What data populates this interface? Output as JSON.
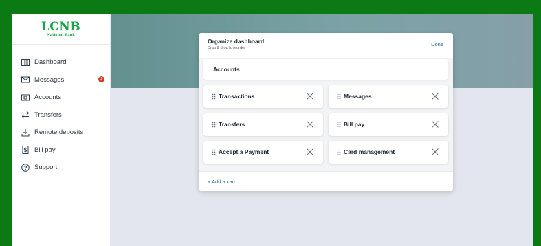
{
  "brand": {
    "name": "LCNB",
    "tagline": "National Bank",
    "color": "#16a34a"
  },
  "sidebar": {
    "items": [
      {
        "label": "Dashboard",
        "icon": "dashboard-icon"
      },
      {
        "label": "Messages",
        "icon": "mail-icon",
        "badge": "2"
      },
      {
        "label": "Accounts",
        "icon": "account-icon"
      },
      {
        "label": "Transfers",
        "icon": "transfer-icon"
      },
      {
        "label": "Remote deposits",
        "icon": "deposit-icon"
      },
      {
        "label": "Bill pay",
        "icon": "bill-icon"
      },
      {
        "label": "Support",
        "icon": "help-icon"
      }
    ]
  },
  "modal": {
    "title": "Organize dashboard",
    "subtitle": "Drag & drop to reorder",
    "done_label": "Done",
    "pinned_card": "Accounts",
    "cards": [
      {
        "label": "Transactions"
      },
      {
        "label": "Messages"
      },
      {
        "label": "Transfers"
      },
      {
        "label": "Bill pay"
      },
      {
        "label": "Accept a Payment"
      },
      {
        "label": "Card management"
      }
    ],
    "add_label": "+ Add a card"
  },
  "colors": {
    "accent": "#2f6f93",
    "badge": "#d64022",
    "frame": "#0c7a14",
    "hero": "#6f9a9c"
  }
}
